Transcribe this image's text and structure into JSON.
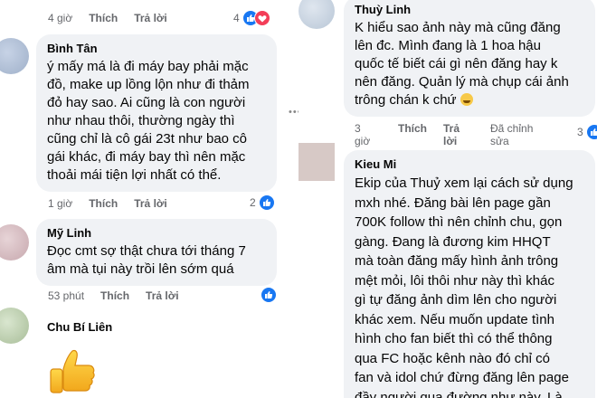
{
  "left": {
    "top_meta": {
      "time": "4 giờ",
      "like": "Thích",
      "reply": "Trả lời",
      "count": "4"
    },
    "c1": {
      "name": "Bình Tân",
      "lines": [
        "ý mấy má là đi máy bay phải mặc",
        "đồ, make up lồng lộn như đi thảm",
        "đỏ hay sao. Ai cũng là con người",
        "như nhau thôi, thường ngày thì",
        "cũng chỉ là cô gái 23t như bao cô",
        "gái khác, đi máy bay thì nên mặc",
        "thoải mái tiện lợi nhất có thể."
      ],
      "time": "1 giờ",
      "like": "Thích",
      "reply": "Trả lời",
      "count": "2"
    },
    "c2": {
      "name": "Mỹ Linh",
      "lines": [
        "Đọc cmt sợ thật chưa tới tháng 7",
        "âm mà tụi này trồi lên sớm quá"
      ],
      "time": "53 phút",
      "like": "Thích",
      "reply": "Trả lời"
    },
    "c3": {
      "name": "Chu Bí Liên",
      "sticker": "thumbs-up"
    }
  },
  "right": {
    "c1": {
      "name": "Thuỳ Linh",
      "lines": [
        "K hiểu sao ảnh này mà cũng đăng",
        "lên đc. Mình đang là 1 hoa hậu",
        "quốc tế biết cái gì nên đăng hay k",
        "nên đăng. Quản lý mà chụp cái ảnh",
        "trông chán k chứ"
      ],
      "time_a": "3",
      "time_b": "giờ",
      "like": "Thích",
      "reply_a": "Trả",
      "reply_b": "lời",
      "edited_a": "Đã chỉnh",
      "edited_b": "sửa",
      "count": "3"
    },
    "c2": {
      "name": "Kieu Mi",
      "lines": [
        "Ekip của Thuỷ xem lại cách sử dụng",
        "mxh nhé. Đăng bài lên page gần",
        "700K follow thì nên chỉnh chu, gọn",
        "gàng. Đang là đương kim HHQT",
        "mà toàn đăng mấy hình ảnh trông",
        "mệt mỏi, lôi thôi như này thì khác",
        "gì tự đăng ảnh dìm lên cho người",
        "khác xem. Nếu muốn update tình",
        "hình cho fan biết thì có thể thông",
        "qua FC hoặc kênh nào đó chỉ có",
        "fan và idol chứ đừng đăng lên page",
        "đầy người qua đường như này. Là"
      ]
    }
  },
  "divider_dots": "•••",
  "colors": {
    "accent": "#1877f2",
    "heart": "#f33e58",
    "bubble": "#f0f2f5",
    "meta": "#65676b"
  }
}
